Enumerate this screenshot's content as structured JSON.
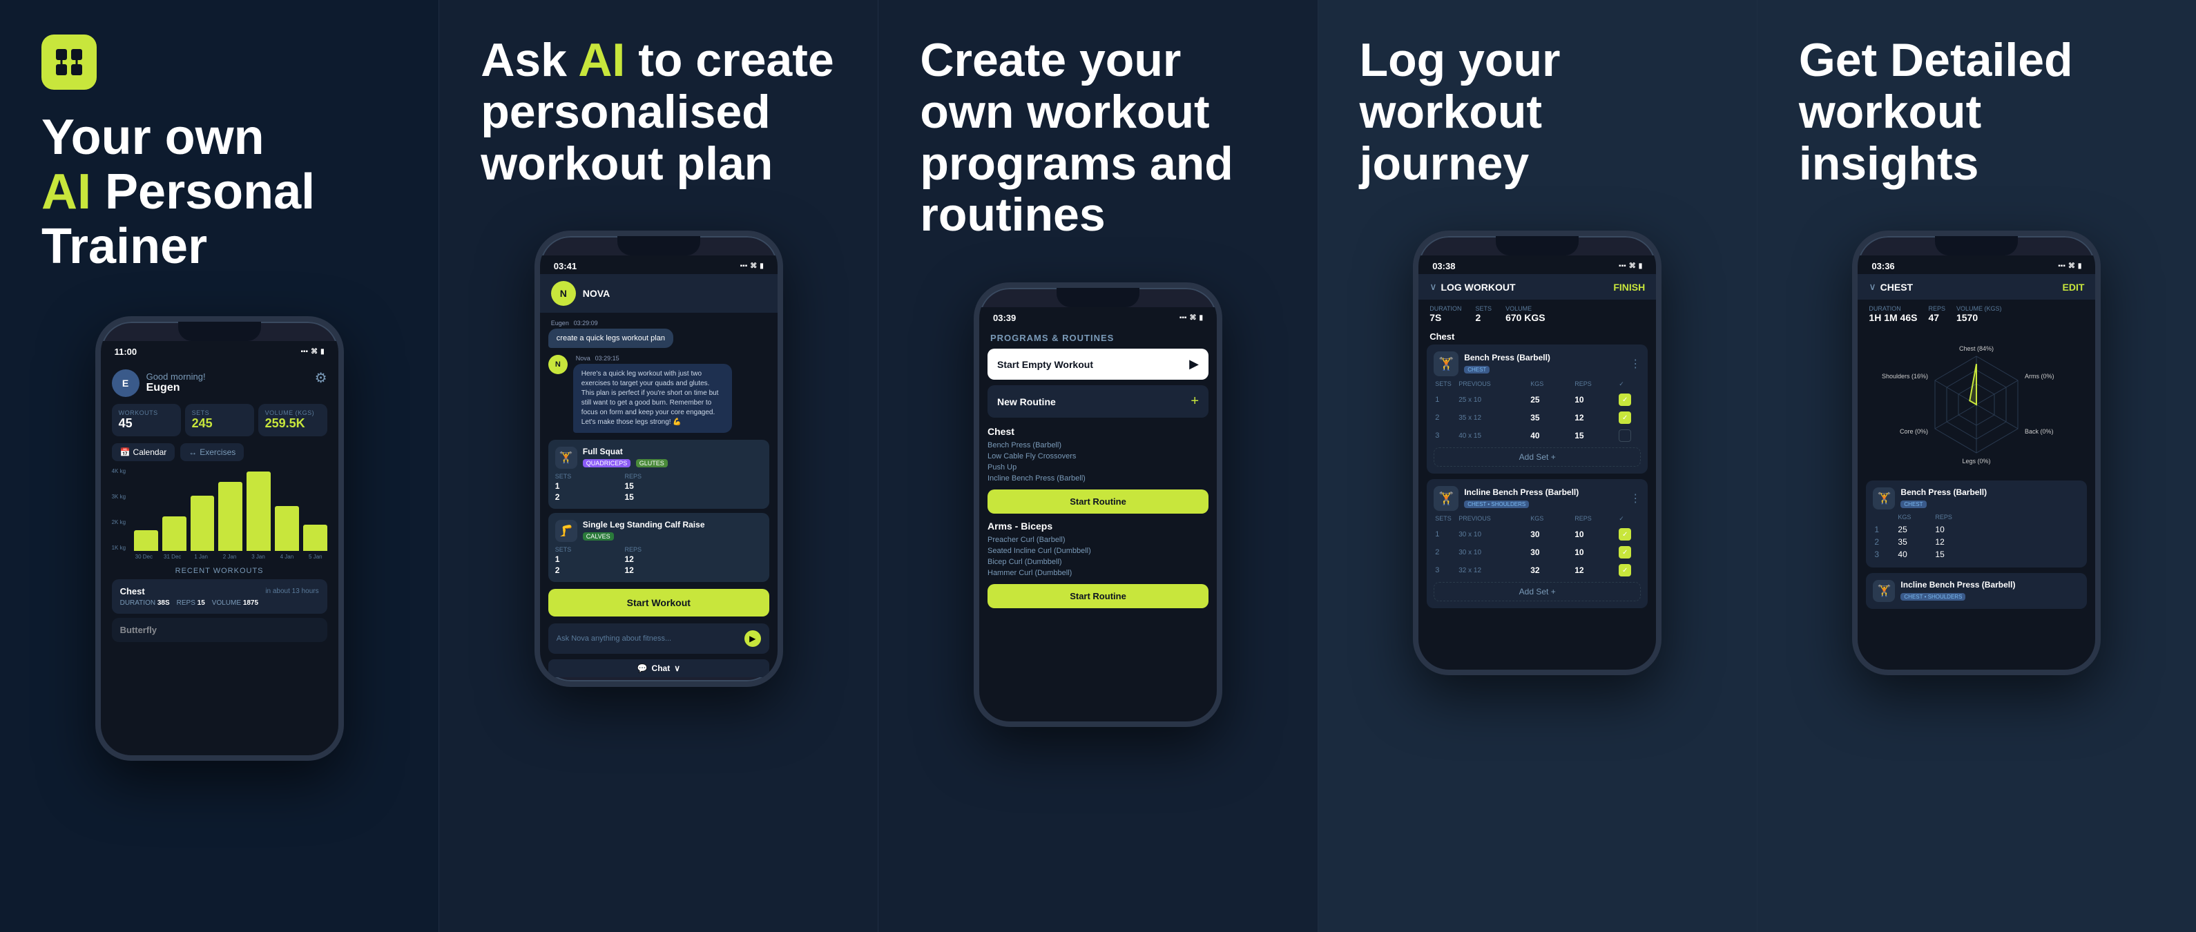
{
  "panels": [
    {
      "id": "panel-1",
      "type": "hero",
      "logo_symbol": "⊞",
      "title_line1": "Your own",
      "title_ai": "AI",
      "title_line2": "Personal Trainer",
      "phone": {
        "time": "11:00",
        "greeting": "Good morning!",
        "user": "Eugen",
        "stats": [
          {
            "label": "WORKOUTS",
            "value": "45",
            "yellow": false
          },
          {
            "label": "SETS",
            "value": "245",
            "yellow": true
          },
          {
            "label": "VOLUME (KGS)",
            "value": "259.5K",
            "yellow": true
          }
        ],
        "tabs": [
          "Calendar",
          "Exercises"
        ],
        "chart_bars": [
          {
            "height": 40,
            "label": "30 Dec"
          },
          {
            "height": 60,
            "label": "31 Dec"
          },
          {
            "height": 90,
            "label": "1 Jan"
          },
          {
            "height": 110,
            "label": "2 Jan"
          },
          {
            "height": 130,
            "label": "3 Jan"
          },
          {
            "height": 75,
            "label": "4 Jan"
          },
          {
            "height": 45,
            "label": "5 Jan"
          }
        ],
        "chart_y_labels": [
          "4K kg",
          "3K kg",
          "2K kg",
          "1K kg"
        ],
        "recent_label": "RECENT WORKOUTS",
        "workouts": [
          {
            "name": "Chest",
            "time": "in about 13 hours",
            "duration": "38S",
            "reps": "15",
            "volume": "1875"
          },
          {
            "name": "Butterfly",
            "time": "",
            "duration": "",
            "reps": "",
            "volume": ""
          }
        ]
      }
    },
    {
      "id": "panel-2",
      "type": "feature",
      "heading_prefix": "Ask ",
      "heading_ai": "AI",
      "heading_suffix": " to create personalised workout plan",
      "phone": {
        "time": "03:41",
        "app_name": "NOVA",
        "chat": [
          {
            "sender": "Eugen",
            "time": "03:29:09",
            "message": "create a quick legs workout plan",
            "is_user": true
          },
          {
            "sender": "Nova",
            "time": "03:29:15",
            "message": "Here's a quick leg workout with just two exercises to target your quads and glutes. This plan is perfect if you're short on time but still want to get a good burn. Remember to focus on form and keep your core engaged. Let's make those legs strong! 💪",
            "is_user": false
          }
        ],
        "exercises": [
          {
            "name": "Full Squat",
            "tags": [
              "QUADRICEPS",
              "GLUTES"
            ],
            "sets": [
              {
                "set": 1,
                "reps": 15
              },
              {
                "set": 2,
                "reps": 15
              }
            ]
          },
          {
            "name": "Single Leg Standing Calf Raise",
            "tags": [
              "CALVES"
            ],
            "sets": [
              {
                "set": 1,
                "reps": 12
              },
              {
                "set": 2,
                "reps": 12
              }
            ]
          }
        ],
        "start_btn": "Start Workout",
        "input_placeholder": "Ask Nova anything about fitness...",
        "chat_tab": "Chat"
      }
    },
    {
      "id": "panel-3",
      "type": "feature",
      "heading": "Create your own workout programs and routines",
      "phone": {
        "time": "03:39",
        "header": "PROGRAMS & ROUTINES",
        "start_empty": "Start Empty Workout",
        "new_routine": "New Routine",
        "sections": [
          {
            "name": "Chest",
            "exercises": [
              "Bench Press (Barbell)",
              "Low Cable Fly Crossovers",
              "Push Up",
              "Incline Bench Press (Barbell)"
            ],
            "btn": "Start Routine"
          },
          {
            "name": "Arms - Biceps",
            "exercises": [
              "Preacher Curl (Barbell)",
              "Seated Incline Curl (Dumbbell)",
              "Bicep Curl (Dumbbell)",
              "Hammer Curl (Dumbbell)"
            ],
            "btn": "Start Routine"
          }
        ]
      }
    },
    {
      "id": "panel-4",
      "type": "feature",
      "heading": "Log your workout journey",
      "phone": {
        "time": "03:38",
        "title": "LOG WORKOUT",
        "finish": "FINISH",
        "stats": [
          {
            "label": "DURATION",
            "value": "7S"
          },
          {
            "label": "SETS",
            "value": "2"
          },
          {
            "label": "VOLUME",
            "value": "670 KGS"
          }
        ],
        "section": "Chest",
        "exercises": [
          {
            "name": "Bench Press (Barbell)",
            "tag": "CHEST",
            "sets": [
              {
                "num": 1,
                "prev": "25 x 10",
                "kgs": "25",
                "reps": "10",
                "done": true
              },
              {
                "num": 2,
                "prev": "35 x 12",
                "kgs": "35",
                "reps": "12",
                "done": true
              },
              {
                "num": 3,
                "prev": "40 x 15",
                "kgs": "40",
                "reps": "15",
                "done": false
              }
            ],
            "add_set": "Add Set +"
          },
          {
            "name": "Incline Bench Press (Barbell)",
            "tag": "CHEST • SHOULDERS",
            "sets": [
              {
                "num": 1,
                "prev": "30 x 10",
                "kgs": "30",
                "reps": "10",
                "done": true
              },
              {
                "num": 2,
                "prev": "30 x 10",
                "kgs": "30",
                "reps": "10",
                "done": true
              },
              {
                "num": 3,
                "prev": "32 x 12",
                "kgs": "32",
                "reps": "12",
                "done": true
              }
            ],
            "add_set": "Add Set +"
          }
        ]
      }
    },
    {
      "id": "panel-5",
      "type": "feature",
      "heading": "Get Detailed workout insights",
      "phone": {
        "time": "03:36",
        "title": "CHEST",
        "edit": "EDIT",
        "stats": [
          {
            "label": "DURATION",
            "value": "1H 1M 46S"
          },
          {
            "label": "REPS",
            "value": "47"
          },
          {
            "label": "VOLUME (KGS)",
            "value": "1570"
          }
        ],
        "radar_labels": [
          {
            "label": "Chest (84%)",
            "angle": 90,
            "pct": 84
          },
          {
            "label": "Arms (0%)",
            "angle": 30,
            "pct": 0
          },
          {
            "label": "Back (0%)",
            "angle": 330,
            "pct": 0
          },
          {
            "label": "Shoulders (16%)",
            "angle": 210,
            "pct": 16
          },
          {
            "label": "Legs (0%)",
            "angle": 270,
            "pct": 0
          },
          {
            "label": "Core (0%)",
            "angle": 150,
            "pct": 0
          }
        ],
        "exercises": [
          {
            "name": "Bench Press (Barbell)",
            "tag": "CHEST",
            "sets": [
              {
                "num": 1,
                "kgs": "25",
                "reps": "10"
              },
              {
                "num": 2,
                "kgs": "35",
                "reps": "12"
              },
              {
                "num": 3,
                "kgs": "40",
                "reps": "15"
              }
            ]
          },
          {
            "name": "Incline Bench Press (Barbell)",
            "tag": "CHEST • SHOULDERS",
            "sets": []
          }
        ]
      }
    }
  ]
}
